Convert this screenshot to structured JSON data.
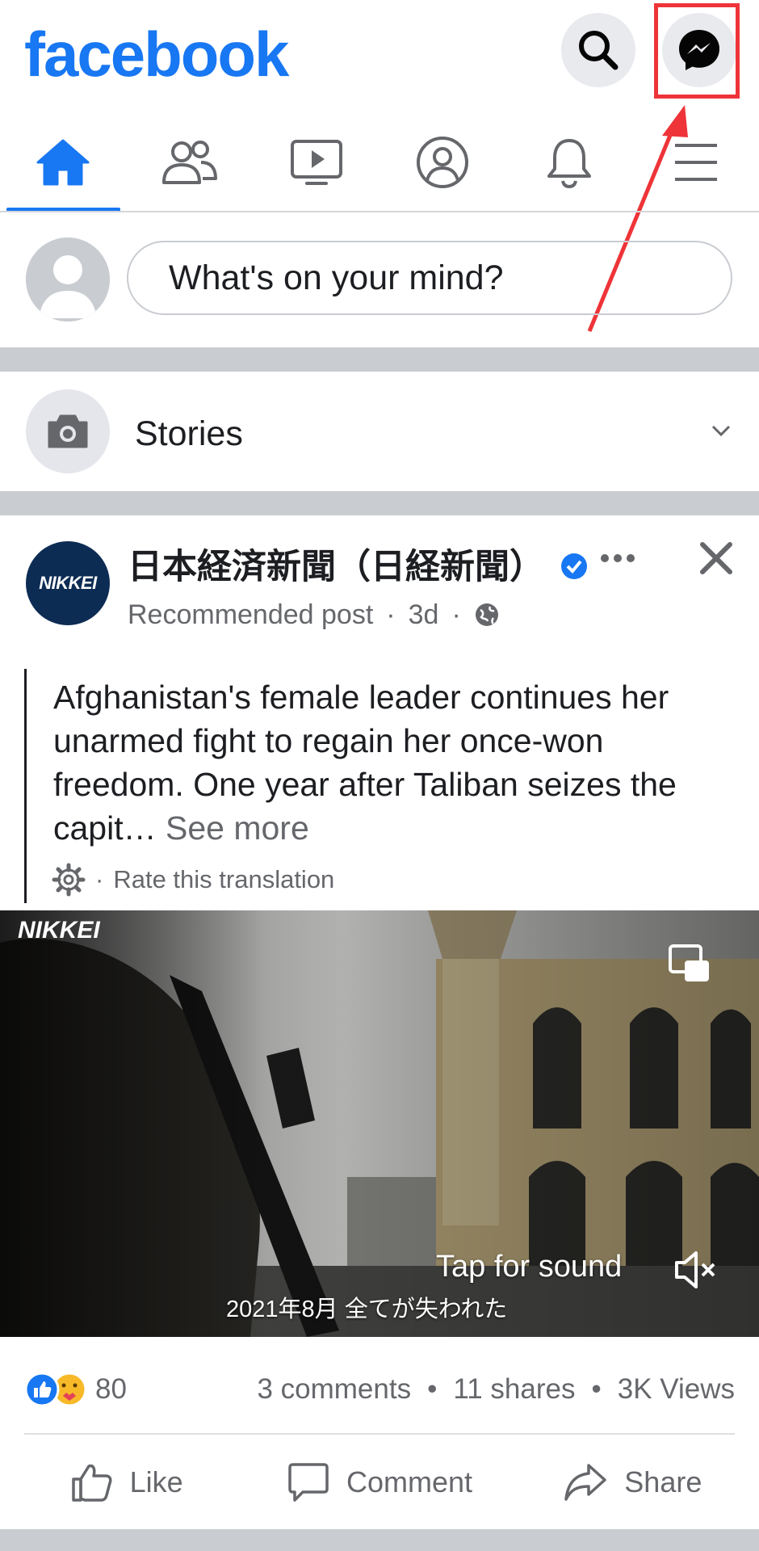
{
  "header": {
    "logo": "facebook",
    "search_icon": "search-icon",
    "messenger_icon": "messenger-icon",
    "brand_color": "#1877f2",
    "annotation_color": "#ee3438"
  },
  "nav": {
    "items": [
      {
        "icon": "home-icon",
        "active": true
      },
      {
        "icon": "friends-icon",
        "active": false
      },
      {
        "icon": "watch-icon",
        "active": false
      },
      {
        "icon": "profile-icon",
        "active": false
      },
      {
        "icon": "bell-icon",
        "active": false
      },
      {
        "icon": "menu-icon",
        "active": false
      }
    ]
  },
  "composer": {
    "placeholder": "What's on your mind?"
  },
  "stories": {
    "label": "Stories"
  },
  "post": {
    "page_name": "日本経済新聞（日経新聞）",
    "avatar_text": "NIKKEI",
    "meta_label": "Recommended post",
    "meta_dot": "·",
    "time": "3d",
    "text": "Afghanistan's female leader continues her unarmed fight to regain her once-won freedom. One year after Taliban seizes the capit… ",
    "see_more": "See more",
    "translation_dot": "·",
    "translation": "Rate this translation",
    "video": {
      "watermark": "NIKKEI",
      "tap_for_sound": "Tap for sound",
      "subtitle": "2021年8月 全てが失われた"
    },
    "reaction_count": "80",
    "comments": "3 comments",
    "bullet": "•",
    "shares": "11 shares",
    "views": "3K Views",
    "actions": {
      "like": "Like",
      "comment": "Comment",
      "share": "Share"
    }
  }
}
